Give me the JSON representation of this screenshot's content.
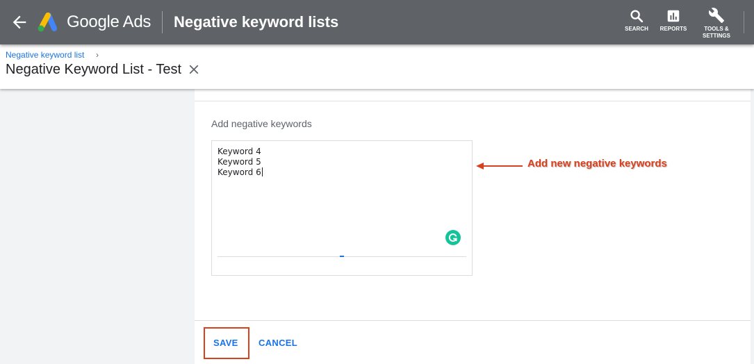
{
  "topbar": {
    "brand": "Google Ads",
    "page_title": "Negative keyword lists",
    "tools": [
      {
        "label": "SEARCH",
        "icon": "search-icon"
      },
      {
        "label": "REPORTS",
        "icon": "bar-chart-icon"
      },
      {
        "label_line1": "TOOLS &",
        "label_line2": "SETTINGS",
        "icon": "wrench-icon"
      }
    ],
    "colors": {
      "bar": "#5f6368",
      "text": "#ffffff"
    }
  },
  "breadcrumb": {
    "link": "Negative keyword list",
    "separator": "›"
  },
  "list": {
    "name": "Negative Keyword List - Test"
  },
  "form": {
    "label": "Add negative keywords",
    "keywords": [
      "Keyword 4",
      "Keyword 5",
      "Keyword 6"
    ],
    "save_label": "SAVE",
    "cancel_label": "CANCEL"
  },
  "annotation": {
    "text": "Add new negative keywords",
    "color": "#d9411e"
  },
  "colors": {
    "accent": "#1a73e8",
    "annotation": "#d9411e",
    "grammarly": "#15c39a",
    "panel": "#f1f3f4"
  }
}
